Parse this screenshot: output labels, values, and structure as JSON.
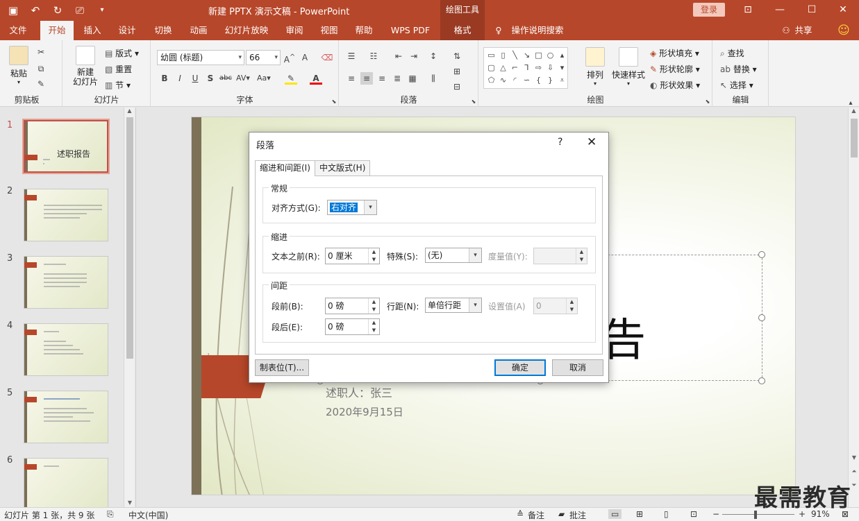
{
  "titlebar": {
    "title": "新建 PPTX 演示文稿  -  PowerPoint",
    "tools_tab": "绘图工具",
    "login": "登录"
  },
  "menu": {
    "tabs": [
      "文件",
      "开始",
      "插入",
      "设计",
      "切换",
      "动画",
      "幻灯片放映",
      "审阅",
      "视图",
      "帮助",
      "WPS PDF",
      "格式"
    ],
    "search": "操作说明搜索",
    "share": "共享"
  },
  "ribbon": {
    "clipboard": {
      "paste": "粘贴",
      "label": "剪贴板"
    },
    "slides": {
      "new_slide": "新建\n幻灯片",
      "new_slide_1": "新建",
      "new_slide_2": "幻灯片",
      "layout": "版式",
      "reset": "重置",
      "section": "节",
      "label": "幻灯片"
    },
    "font": {
      "name": "幼圆 (标题)",
      "size": "66",
      "label": "字体"
    },
    "paragraph": {
      "label": "段落"
    },
    "drawing": {
      "arrange": "排列",
      "quick_styles": "快速样式",
      "fill": "形状填充",
      "outline": "形状轮廓",
      "effects": "形状效果",
      "label": "绘图"
    },
    "editing": {
      "find": "查找",
      "replace": "替换",
      "select": "选择",
      "label": "编辑"
    }
  },
  "thumbnails": {
    "numbers": [
      "1",
      "2",
      "3",
      "4",
      "5",
      "6"
    ],
    "slide1_title": "述职报告"
  },
  "slide": {
    "big_text": "告",
    "reporter": "述职人：张三",
    "date": "2020年9月15日"
  },
  "dialog": {
    "title": "段落",
    "help": "?",
    "close": "✕",
    "tabs": [
      "缩进和间距(I)",
      "中文版式(H)"
    ],
    "general": {
      "legend": "常规",
      "alignment_label": "对齐方式(G):",
      "alignment_value": "右对齐"
    },
    "indent": {
      "legend": "缩进",
      "before_text_label": "文本之前(R):",
      "before_text_value": "0 厘米",
      "special_label": "特殊(S):",
      "special_value": "(无)",
      "measure_label": "度量值(Y):",
      "measure_value": ""
    },
    "spacing": {
      "legend": "间距",
      "before_label": "段前(B):",
      "before_value": "0 磅",
      "line_label": "行距(N):",
      "line_value": "单倍行距",
      "setting_label": "设置值(A)",
      "setting_value": "0",
      "after_label": "段后(E):",
      "after_value": "0 磅"
    },
    "buttons": {
      "tabs": "制表位(T)...",
      "ok": "确定",
      "cancel": "取消"
    }
  },
  "statusbar": {
    "slide_info": "幻灯片 第 1 张，共 9 张",
    "language": "中文(中国)",
    "notes": "备注",
    "comments": "批注",
    "zoom": "91%"
  },
  "watermark": "最需教育",
  "colors": {
    "accent": "#b7472a",
    "dialog_highlight": "#0078d7"
  }
}
